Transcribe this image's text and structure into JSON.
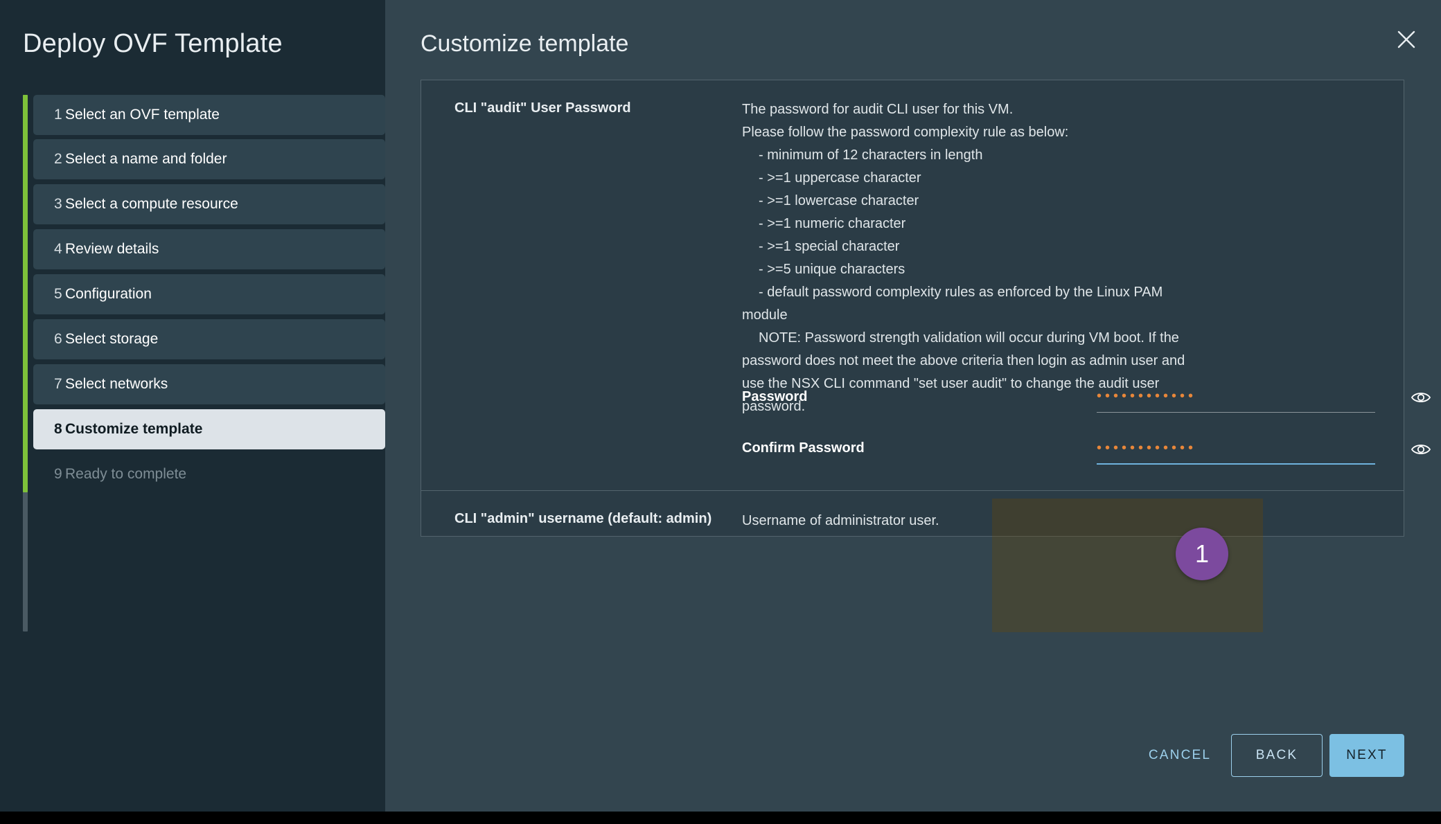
{
  "sidebar": {
    "title": "Deploy OVF Template",
    "steps": [
      {
        "num": "1",
        "label": "Select an OVF template",
        "state": "done"
      },
      {
        "num": "2",
        "label": "Select a name and folder",
        "state": "done"
      },
      {
        "num": "3",
        "label": "Select a compute resource",
        "state": "done"
      },
      {
        "num": "4",
        "label": "Review details",
        "state": "done"
      },
      {
        "num": "5",
        "label": "Configuration",
        "state": "done"
      },
      {
        "num": "6",
        "label": "Select storage",
        "state": "done"
      },
      {
        "num": "7",
        "label": "Select networks",
        "state": "done"
      },
      {
        "num": "8",
        "label": "Customize template",
        "state": "active"
      },
      {
        "num": "9",
        "label": "Ready to complete",
        "state": "disabled"
      }
    ],
    "progress_color": "#7ec13a"
  },
  "main": {
    "title": "Customize template",
    "close_icon": "close-icon"
  },
  "properties": [
    {
      "label": "CLI \"audit\" User Password",
      "desc_lines": [
        "The password for audit CLI user for this VM.",
        "Please follow the password complexity rule as below:",
        "- minimum of 12 characters in length",
        "- >=1 uppercase character",
        "- >=1 lowercase character",
        "- >=1 numeric character",
        "- >=1 special character",
        "- >=5 unique characters",
        "- default password complexity rules as enforced by the Linux PAM module",
        "NOTE: Password strength validation will occur during VM boot.  If the password does not meet the above criteria then login as admin user and use the NSX CLI command \"set user audit\" to change the audit user password."
      ]
    },
    {
      "label": "CLI \"admin\" username (default: admin)",
      "desc_lines": [
        "Username of administrator user."
      ]
    }
  ],
  "password_fields": {
    "password": {
      "label": "Password",
      "value": "••••••••••••",
      "placeholder": "",
      "reveal_icon": "eye-icon",
      "focused": false
    },
    "confirm_password": {
      "label": "Confirm Password",
      "value": "••••••••••••",
      "placeholder": "",
      "reveal_icon": "eye-icon",
      "focused": true
    }
  },
  "highlight": {
    "badge_number": "1",
    "badge_color": "#7c4a9e",
    "overlay_color": "rgba(110,72,0,0.30)"
  },
  "footer": {
    "cancel_label": "CANCEL",
    "back_label": "BACK",
    "next_label": "NEXT",
    "next_color": "#7cc0e3"
  }
}
